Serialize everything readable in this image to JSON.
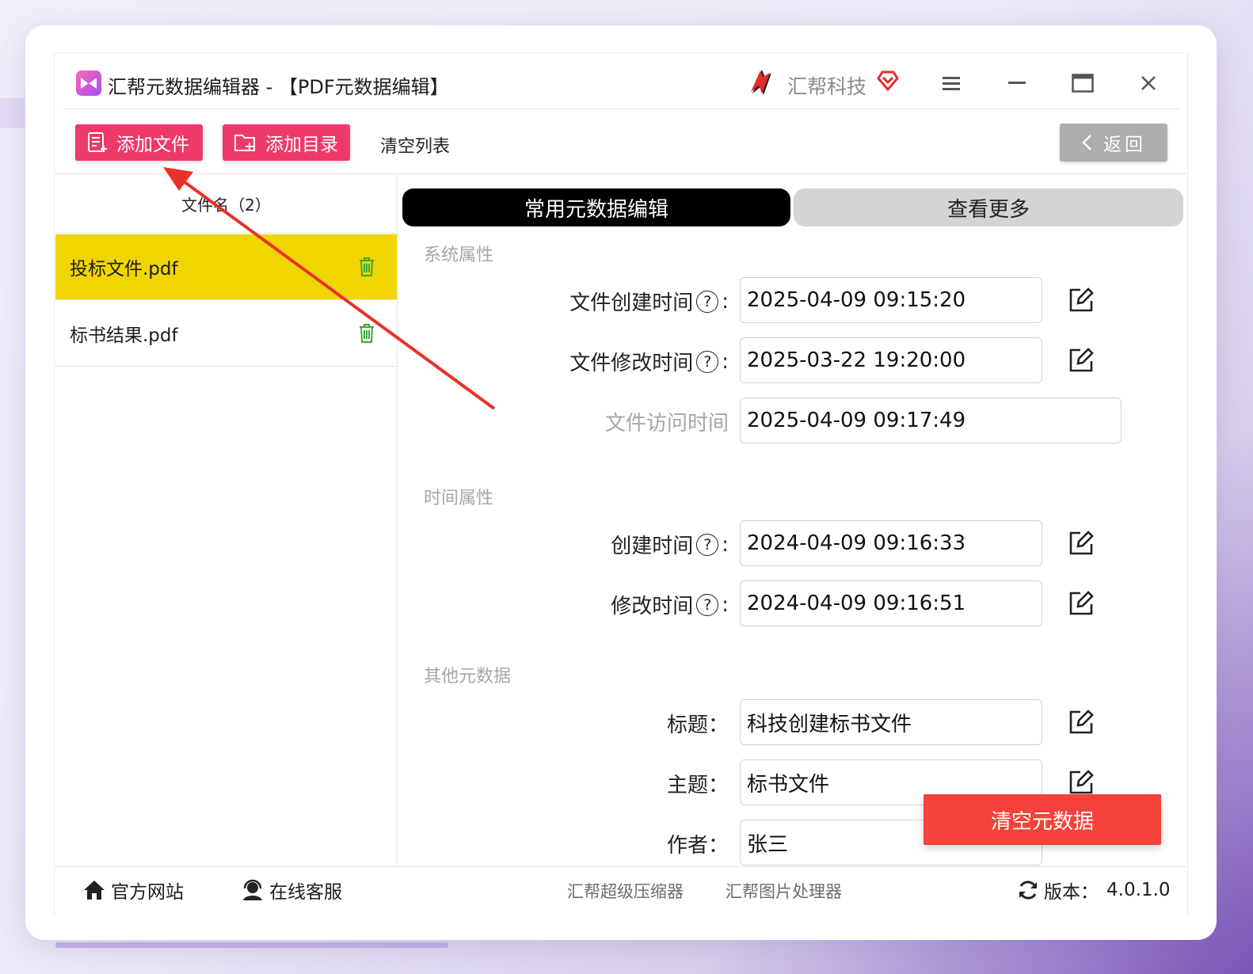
{
  "app": {
    "title": "汇帮元数据编辑器 - 【PDF元数据编辑】",
    "brand_name": "汇帮科技"
  },
  "toolbar": {
    "add_file": "添加文件",
    "add_dir": "添加目录",
    "clear_list": "清空列表",
    "back": "返回"
  },
  "files": {
    "header": "文件名（2）",
    "items": [
      {
        "name": "投标文件.pdf",
        "selected": true
      },
      {
        "name": "标书结果.pdf",
        "selected": false
      }
    ]
  },
  "tabs": {
    "active": "常用元数据编辑",
    "more": "查看更多"
  },
  "sections": {
    "system": "系统属性",
    "time": "时间属性",
    "other": "其他元数据"
  },
  "fields": {
    "file_created": {
      "label": "文件创建时间",
      "value": "2025-04-09 09:15:20"
    },
    "file_modified": {
      "label": "文件修改时间",
      "value": "2025-03-22 19:20:00"
    },
    "file_accessed": {
      "label": "文件访问时间",
      "value": "2025-04-09 09:17:49"
    },
    "created": {
      "label": "创建时间",
      "value": "2024-04-09 09:16:33"
    },
    "modified": {
      "label": "修改时间",
      "value": "2024-04-09 09:16:51"
    },
    "title": {
      "label": "标题：",
      "value": "科技创建标书文件"
    },
    "subject": {
      "label": "主题：",
      "value": "标书文件"
    },
    "author": {
      "label": "作者：",
      "value": "张三"
    }
  },
  "actions": {
    "clear_metadata": "清空元数据"
  },
  "footer": {
    "official_site": "官方网站",
    "online_support": "在线客服",
    "compressor": "汇帮超级压缩器",
    "image_tool": "汇帮图片处理器",
    "version_label": "版本：",
    "version": "4.0.1.0"
  },
  "colors": {
    "primary_button": "#ee3a6a",
    "selected_row": "#f0d500",
    "clear_metadata_button": "#f5423a",
    "annotation_arrow": "#e8322a"
  }
}
